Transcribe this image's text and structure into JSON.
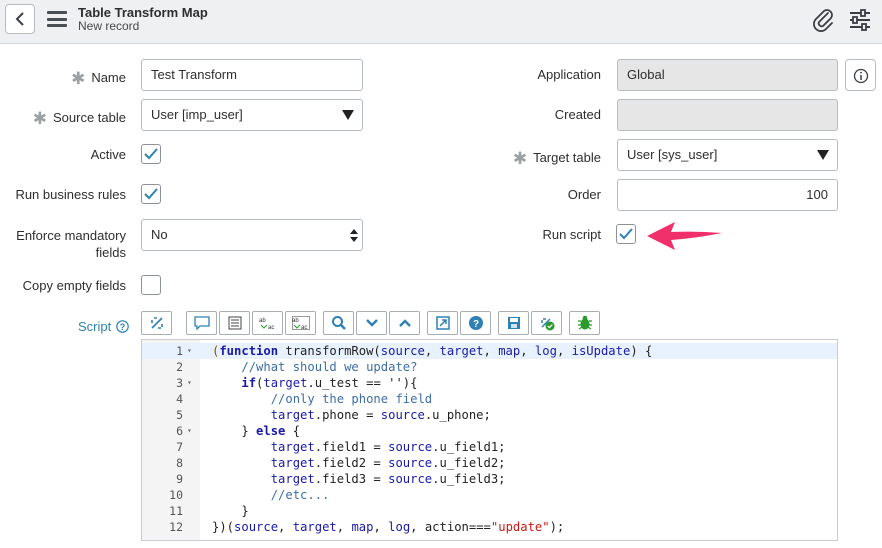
{
  "header": {
    "back_label": "Back",
    "title": "Table Transform Map",
    "subtitle": "New record"
  },
  "form": {
    "name": {
      "label": "Name",
      "value": "Test Transform"
    },
    "source_table": {
      "label": "Source table",
      "value": "User [imp_user]"
    },
    "active": {
      "label": "Active",
      "checked": true
    },
    "run_business_rules": {
      "label": "Run business rules",
      "checked": true
    },
    "enforce_mandatory": {
      "label_line1": "Enforce mandatory",
      "label_line2": "fields",
      "value": "No"
    },
    "copy_empty": {
      "label": "Copy empty fields",
      "checked": false
    },
    "application": {
      "label": "Application",
      "value": "Global"
    },
    "created": {
      "label": "Created",
      "value": ""
    },
    "target_table": {
      "label": "Target table",
      "value": "User [sys_user]"
    },
    "order": {
      "label": "Order",
      "value": "100"
    },
    "run_script": {
      "label": "Run script",
      "checked": true
    },
    "script": {
      "label": "Script"
    }
  },
  "toolbar_icons": [
    "format-code-icon",
    "comment-icon",
    "document-icon",
    "replace-icon",
    "replace-all-icon",
    "search-icon",
    "chevron-down-icon",
    "chevron-up-icon",
    "fullscreen-icon",
    "help-icon",
    "save-icon",
    "check-syntax-icon",
    "debug-icon"
  ],
  "editor": {
    "active_line": 1,
    "lines": [
      {
        "n": "1",
        "fold": true,
        "code": "(function transformRow(source, target, map, log, isUpdate) {"
      },
      {
        "n": "2",
        "fold": false,
        "code": "    //what should we update?"
      },
      {
        "n": "3",
        "fold": true,
        "code": "    if(target.u_test == ''){"
      },
      {
        "n": "4",
        "fold": false,
        "code": "        //only the phone field"
      },
      {
        "n": "5",
        "fold": false,
        "code": "        target.phone = source.u_phone;"
      },
      {
        "n": "6",
        "fold": true,
        "code": "    } else {"
      },
      {
        "n": "7",
        "fold": false,
        "code": "        target.field1 = source.u_field1;"
      },
      {
        "n": "8",
        "fold": false,
        "code": "        target.field2 = source.u_field2;"
      },
      {
        "n": "9",
        "fold": false,
        "code": "        target.field3 = source.u_field3;"
      },
      {
        "n": "10",
        "fold": false,
        "code": "        //etc..."
      },
      {
        "n": "11",
        "fold": false,
        "code": "    }"
      },
      {
        "n": "12",
        "fold": false,
        "code": "})(source, target, map, log, action===\"update\");"
      }
    ]
  },
  "colors": {
    "accent": "#2f80b4",
    "annotation_arrow": "#f0306a",
    "checkmark": "#2f80b4"
  }
}
